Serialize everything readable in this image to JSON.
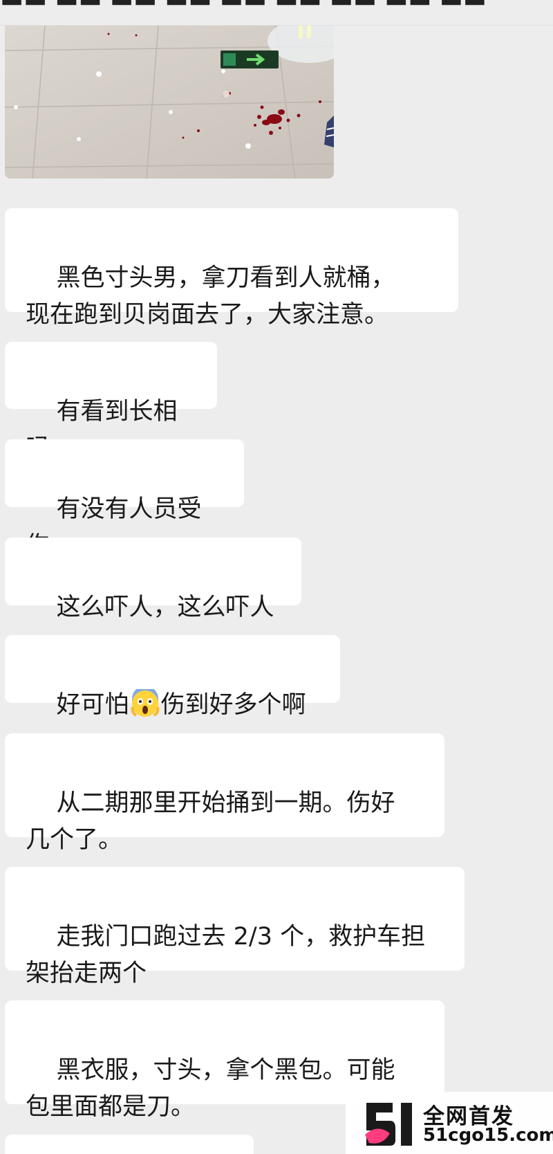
{
  "messages": [
    {
      "text": "黑色寸头男，拿刀看到人就桶，\n现在跑到贝岗面去了，大家注意。"
    },
    {
      "text": "有看到长相吗"
    },
    {
      "text": "有没有人员受伤"
    },
    {
      "text": "这么吓人，这么吓人"
    },
    {
      "text_before": "好可怕",
      "emoji": "screaming-face",
      "text_after": "伤到好多个啊"
    },
    {
      "text": "从二期那里开始捅到一期。伤好\n几个了。"
    },
    {
      "text": "走我门口跑过去 2/3 个，救护车担\n架抬走两个"
    },
    {
      "text": "黑衣服，寸头，拿个黑包。可能\n包里面都是刀。"
    }
  ],
  "watermark": {
    "line1": "全网首发",
    "line2": "51cgo15.com"
  },
  "colors": {
    "background": "#ededed",
    "bubble": "#ffffff",
    "text": "#1a1a1a",
    "logo_dark": "#1a1a1a",
    "logo_pink": "#ff3d7f"
  }
}
